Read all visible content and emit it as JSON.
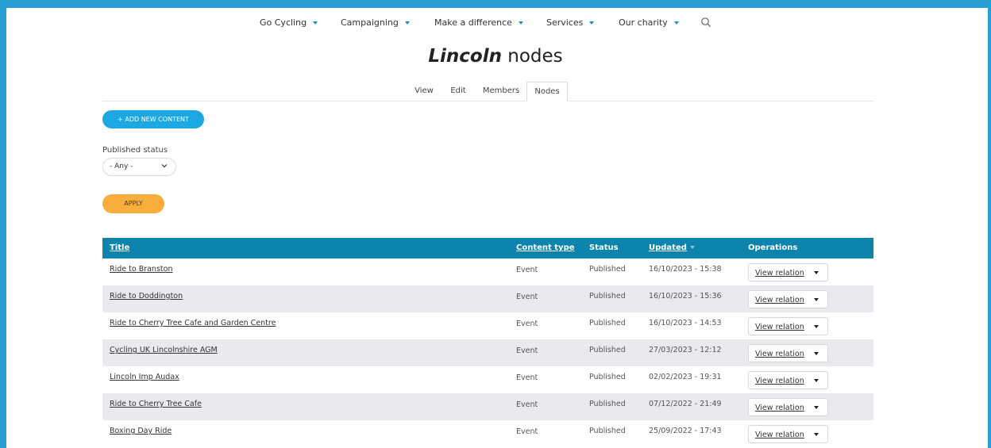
{
  "nav": {
    "items": [
      {
        "label": "Go Cycling"
      },
      {
        "label": "Campaigning"
      },
      {
        "label": "Make a difference"
      },
      {
        "label": "Services"
      },
      {
        "label": "Our charity"
      }
    ],
    "search_icon": "search-icon",
    "caret_color": "#1c8dc9"
  },
  "page": {
    "title_city": "Lincoln",
    "title_rest": "nodes"
  },
  "tabs": [
    {
      "label": "View"
    },
    {
      "label": "Edit"
    },
    {
      "label": "Members"
    },
    {
      "label": "Nodes",
      "active": true
    }
  ],
  "actions": {
    "add_new_label": "+ ADD NEW CONTENT",
    "apply_label": "APPLY"
  },
  "filter": {
    "label": "Published status",
    "selected": "- Any -"
  },
  "table": {
    "headers": {
      "title": "Title",
      "content_type": "Content type",
      "status": "Status",
      "updated": "Updated",
      "operations": "Operations"
    },
    "rows": [
      {
        "title": "Ride to Branston",
        "content_type": "Event",
        "status": "Published",
        "updated": "16/10/2023 - 15:38",
        "operation": "View relation"
      },
      {
        "title": "Ride to Doddington",
        "content_type": "Event",
        "status": "Published",
        "updated": "16/10/2023 - 15:36",
        "operation": "View relation"
      },
      {
        "title": "Ride to Cherry Tree Cafe and Garden Centre",
        "content_type": "Event",
        "status": "Published",
        "updated": "16/10/2023 - 14:53",
        "operation": "View relation"
      },
      {
        "title": "Cycling UK Lincolnshire AGM",
        "content_type": "Event",
        "status": "Published",
        "updated": "27/03/2023 - 12:12",
        "operation": "View relation"
      },
      {
        "title": "Lincoln Imp Audax",
        "content_type": "Event",
        "status": "Published",
        "updated": "02/02/2023 - 19:31",
        "operation": "View relation"
      },
      {
        "title": "Ride to Cherry Tree Cafe",
        "content_type": "Event",
        "status": "Published",
        "updated": "07/12/2022 - 21:49",
        "operation": "View relation"
      },
      {
        "title": "Boxing Day Ride",
        "content_type": "Event",
        "status": "Published",
        "updated": "25/09/2022 - 17:43",
        "operation": "View relation"
      }
    ]
  },
  "colors": {
    "frame": "#2a9fd6",
    "header_bg": "#0d84ad",
    "add_button": "#1ca8e3",
    "apply_button": "#f9ad3b",
    "alt_row": "#e8eaed"
  }
}
